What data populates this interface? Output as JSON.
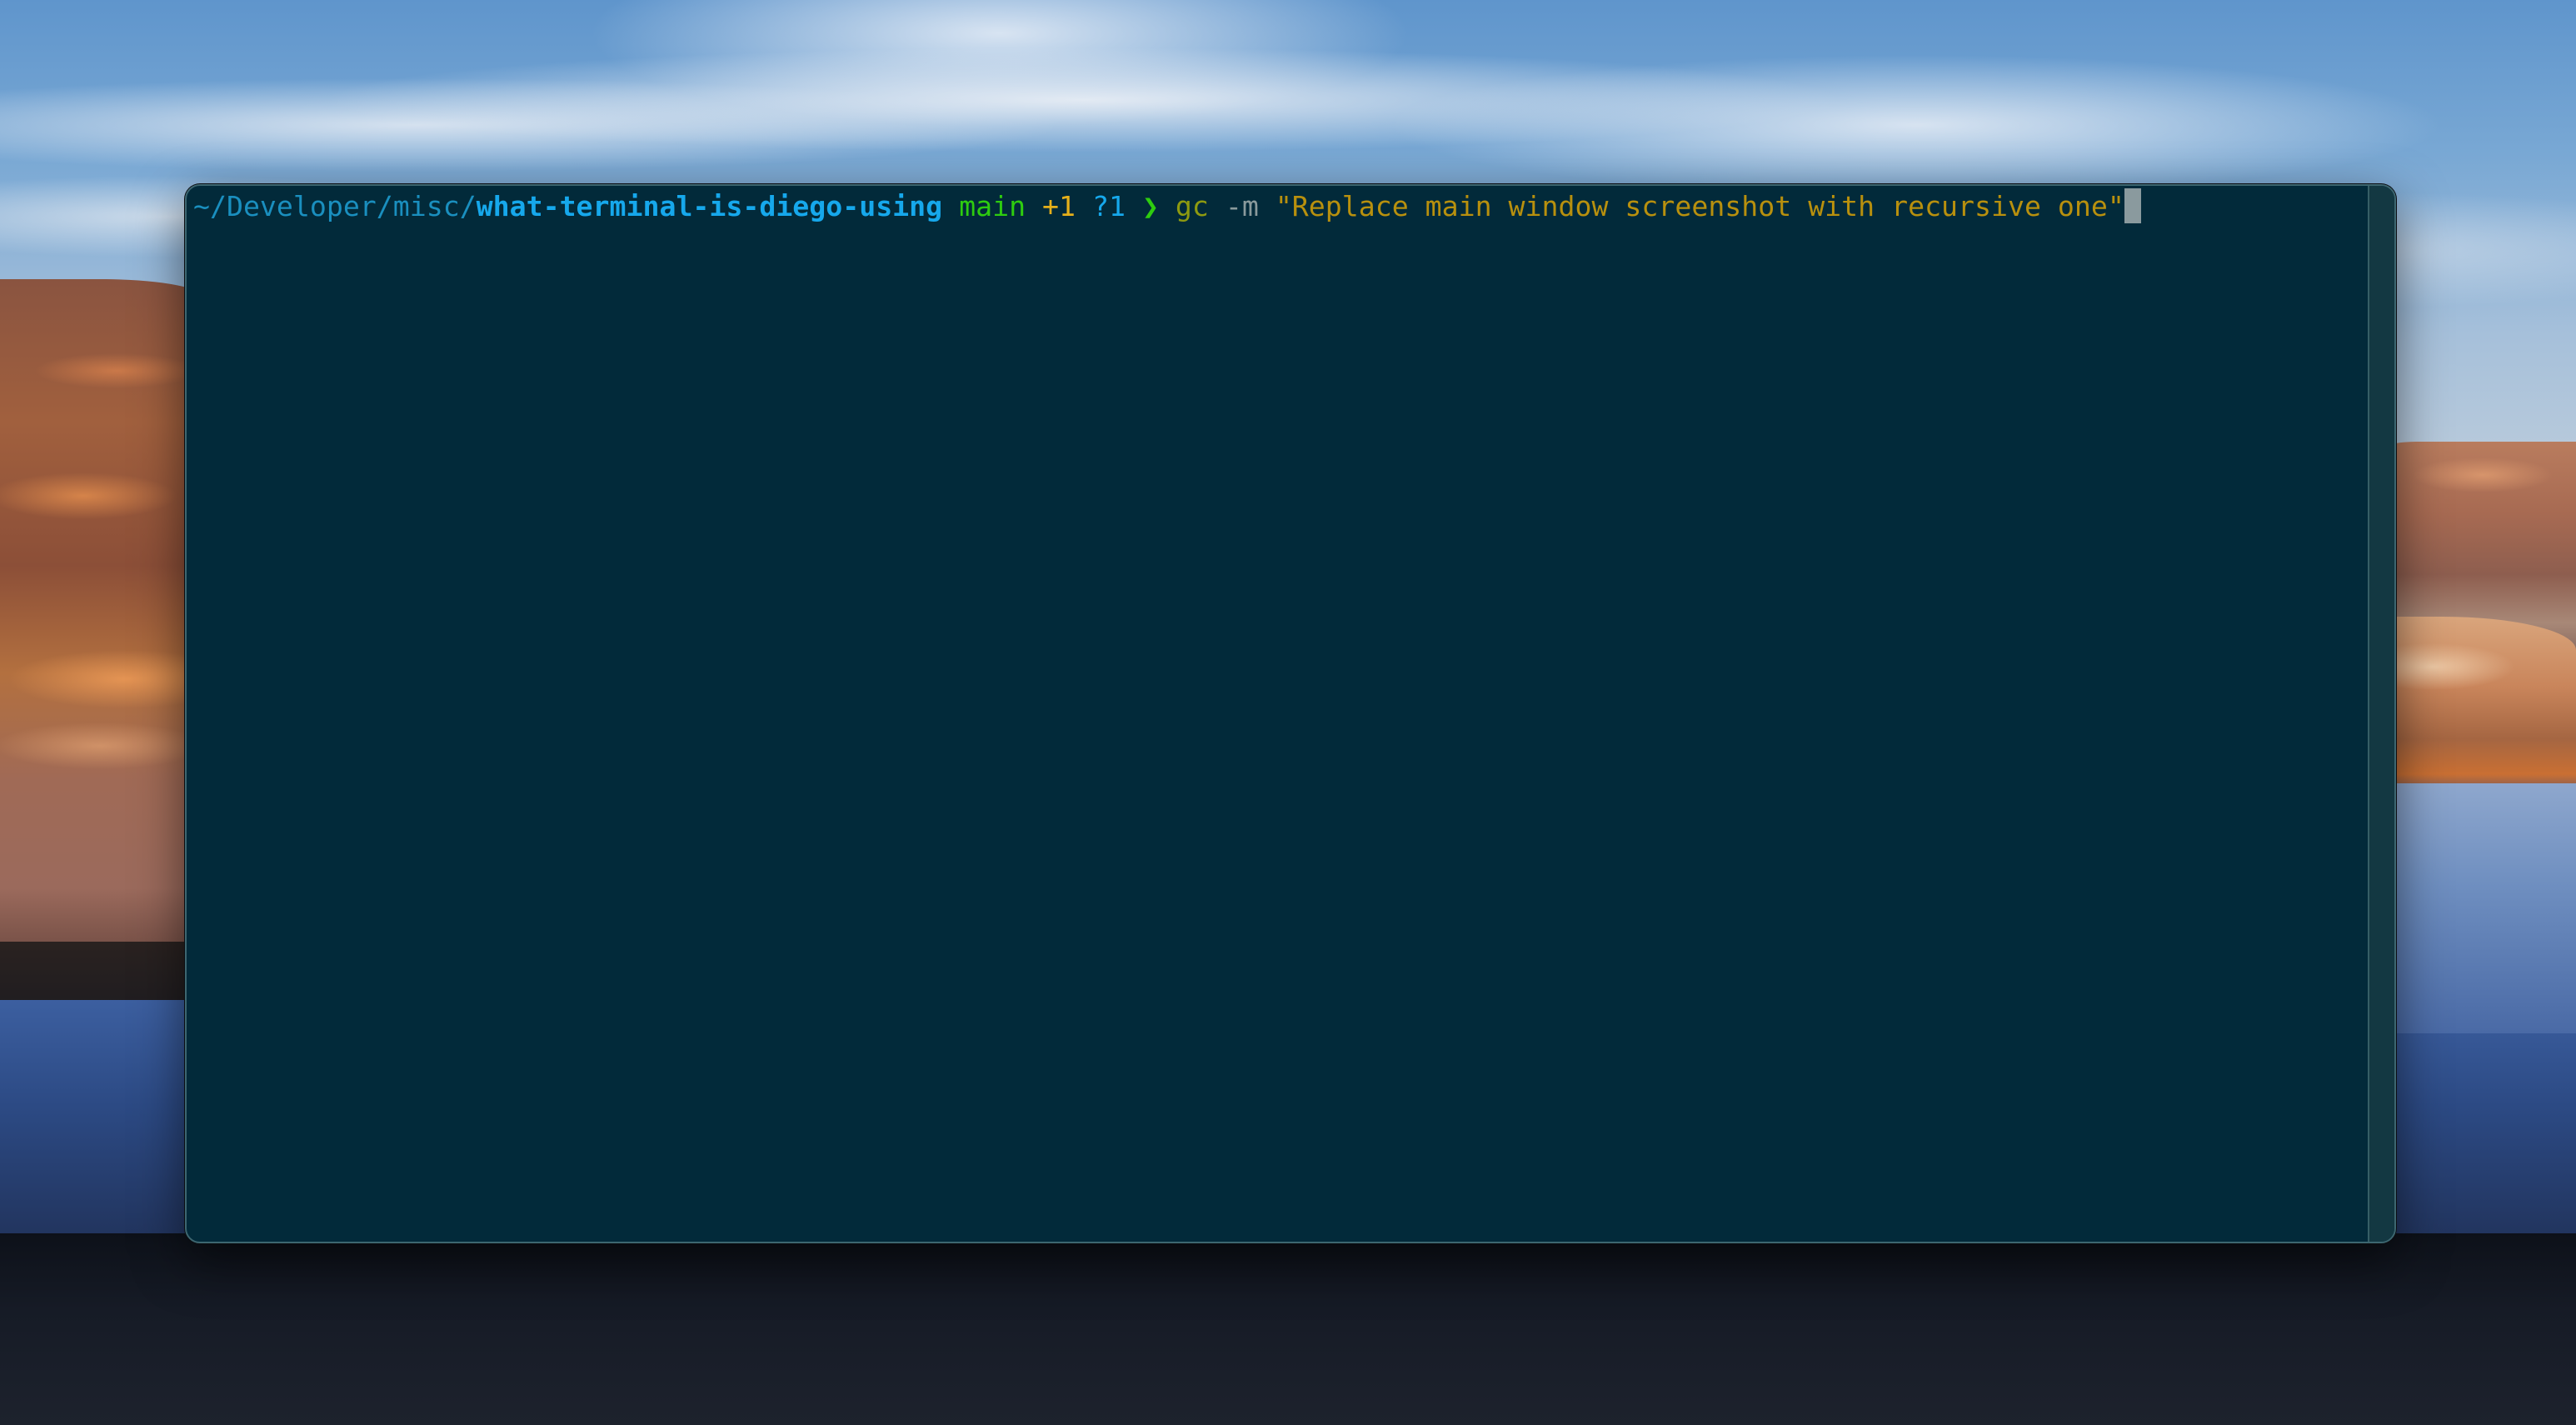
{
  "desktop": {
    "wallpaper": "desert-lake-landscape"
  },
  "terminal": {
    "theme_colors": {
      "background": "#022a3a",
      "path_dim": "#1a8fbf",
      "path_repo": "#16a8ec",
      "branch": "#2ecc0f",
      "staged": "#e6b01a",
      "untracked": "#16a8ec",
      "prompt_symbol": "#2ecc0f",
      "command": "#8e9a10",
      "flag": "#8a9a9c",
      "string": "#b8900e",
      "cursor": "#8a9a9e"
    },
    "prompt": {
      "path_prefix": "~/Developer/misc/",
      "repo_name": "what-terminal-is-diego-using",
      "git_branch": "main",
      "git_staged": "+1",
      "git_untracked": "?1",
      "prompt_symbol": "❯"
    },
    "input": {
      "command": "gc",
      "flag": "-m",
      "argument": "\"Replace main window screenshot with recursive one\""
    }
  }
}
